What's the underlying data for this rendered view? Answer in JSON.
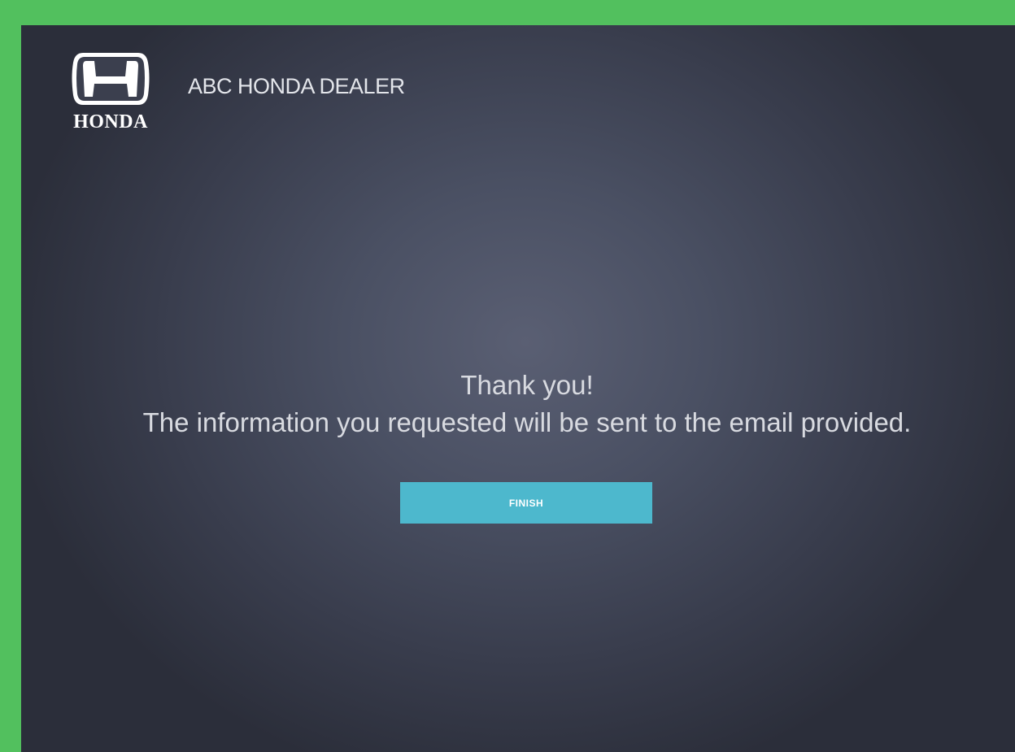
{
  "header": {
    "logo": {
      "icon": "honda-h-logo-icon",
      "wordmark": "HONDA"
    },
    "dealer_name": "ABC HONDA DEALER"
  },
  "main": {
    "title": "Thank you!",
    "message": "The information you requested will be sent to the email provided.",
    "finish_label": "FINISH"
  },
  "colors": {
    "frame_green": "#52c05e",
    "background_dark": "#2b2e3a",
    "background_center": "#5a5f73",
    "button": "#4db8cd",
    "text": "#d8dae0"
  }
}
